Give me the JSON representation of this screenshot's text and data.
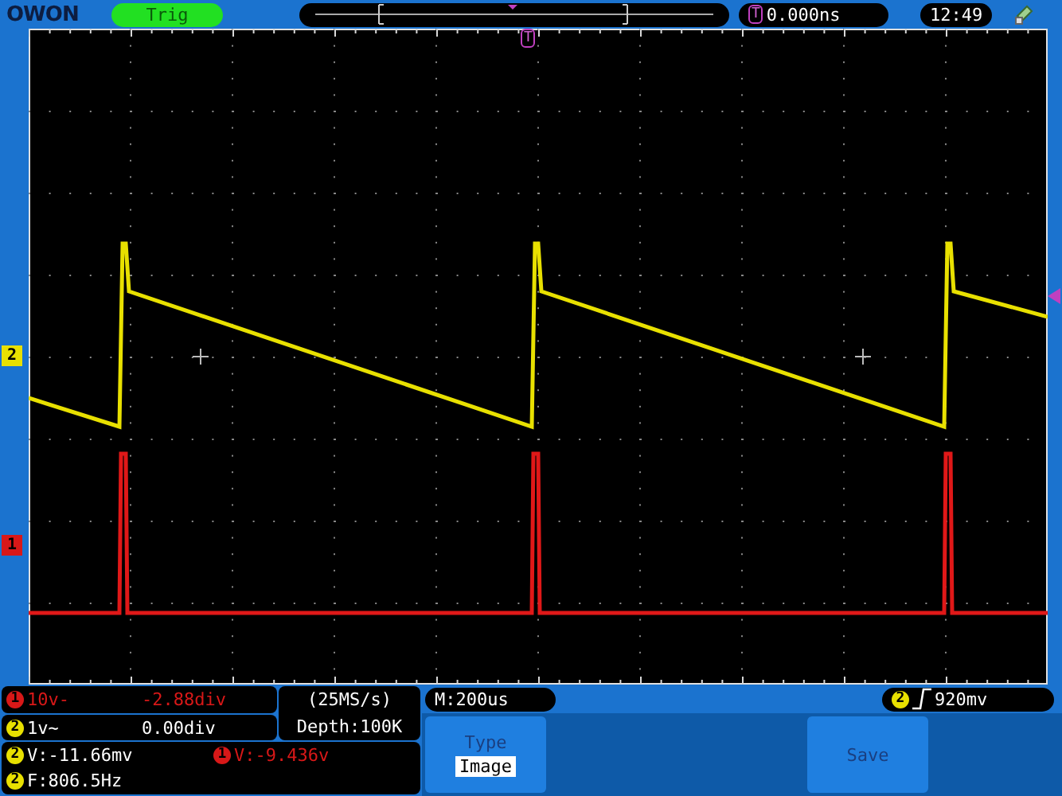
{
  "top_bar": {
    "logo": "OWON",
    "status": "Trig",
    "trigger_position": "T",
    "trigger_time": "0.000ns",
    "clock": "12:49"
  },
  "screen": {
    "trigger_marker": "T",
    "channel_markers": [
      {
        "label": "2",
        "color": "#e8e000"
      },
      {
        "label": "1",
        "color": "#d81818"
      }
    ]
  },
  "channels": [
    {
      "badge": "1",
      "color": "#d81818",
      "kind": "tinted",
      "scale": "10v-",
      "offset": "-2.88div"
    },
    {
      "badge": "2",
      "color": "#e8e000",
      "kind": "plain",
      "scale": "1v~",
      "offset": "0.00div"
    }
  ],
  "acquisition": {
    "sample_rate": "(25MS/s)",
    "depth": "Depth:100K"
  },
  "timebase": "M:200us",
  "trigger": {
    "badge": "2",
    "color": "#e8e000",
    "level": "920mv"
  },
  "measurements": [
    {
      "badge": "2",
      "color": "#e8e000",
      "kind": "plain",
      "text": "V:-11.66mv"
    },
    {
      "badge": "1",
      "color": "#d81818",
      "kind": "tinted",
      "text": "V:-9.436v"
    },
    {
      "badge": "2",
      "color": "#e8e000",
      "kind": "plain",
      "text": "F:806.5Hz"
    }
  ],
  "menu": [
    {
      "kind": "option",
      "label": "Type",
      "value": "Image"
    },
    {
      "kind": "blank"
    },
    {
      "kind": "blank"
    },
    {
      "kind": "action",
      "label": "Save"
    }
  ]
}
